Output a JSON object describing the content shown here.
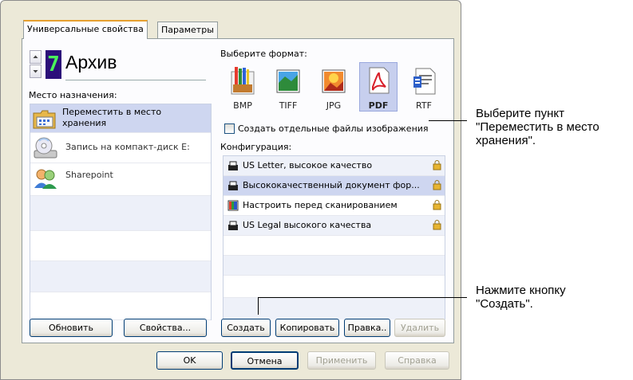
{
  "tabs": [
    "Универсальные свойства",
    "Параметры"
  ],
  "profile": {
    "digit": "7",
    "name": "Архив"
  },
  "destination": {
    "label": "Место назначения:",
    "items": [
      {
        "line1": "Переместить в место",
        "line2": "хранения",
        "icon": "folder-icon",
        "selected": true
      },
      {
        "line1": "Запись на компакт-диск  E:",
        "line2": "",
        "icon": "cd-drive-icon",
        "selected": false
      },
      {
        "line1": "Sharepoint",
        "line2": "",
        "icon": "sharepoint-icon",
        "selected": false
      }
    ]
  },
  "format": {
    "label": "Выберите формат:",
    "items": [
      {
        "label": "BMP",
        "icon": "bmp-icon"
      },
      {
        "label": "TIFF",
        "icon": "tiff-icon"
      },
      {
        "label": "JPG",
        "icon": "jpg-icon"
      },
      {
        "label": "PDF",
        "icon": "pdf-icon",
        "selected": true
      },
      {
        "label": "RTF",
        "icon": "rtf-icon"
      }
    ],
    "separate_files_label": "Создать отдельные файлы изображения",
    "separate_files_checked": false
  },
  "config": {
    "label": "Конфигурация:",
    "items": [
      {
        "label": "US Letter, высокое качество",
        "icon": "scanner-icon"
      },
      {
        "label": "Высококачественный документ фор...",
        "icon": "scanner-icon",
        "selected": true
      },
      {
        "label": "Настроить перед сканированием",
        "icon": "configure-icon"
      },
      {
        "label": "US Legal высокого качества",
        "icon": "scanner-icon"
      }
    ]
  },
  "buttons": {
    "refresh": "Обновить",
    "properties": "Свойства...",
    "create": "Создать",
    "copy": "Копировать",
    "edit": "Правка..",
    "delete": "Удалить",
    "ok": "OK",
    "cancel": "Отмена",
    "apply": "Применить",
    "help": "Справка"
  },
  "callouts": {
    "first": [
      "Выберите пункт",
      "\"Переместить в место",
      "хранения\"."
    ],
    "second": [
      "Нажмите кнопку",
      "\"Создать\"."
    ]
  }
}
